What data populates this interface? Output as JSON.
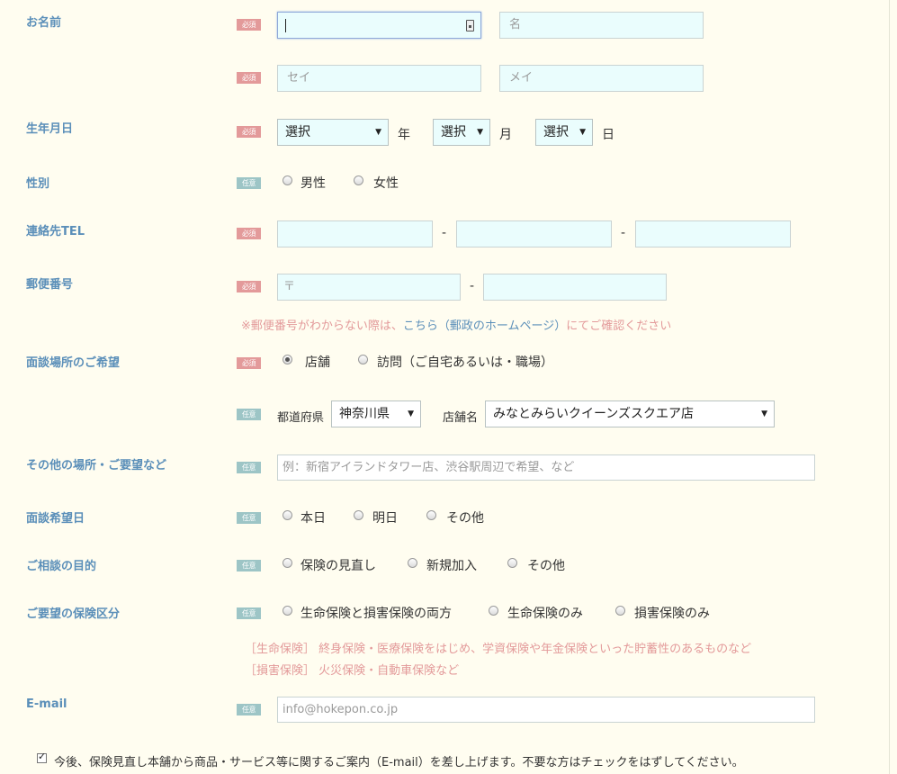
{
  "badges": {
    "required": "必須",
    "optional": "任意"
  },
  "name": {
    "label": "お名前",
    "sei_placeholder": "",
    "mei_placeholder": "名",
    "kana_sei_placeholder": "セイ",
    "kana_mei_placeholder": "メイ"
  },
  "birth": {
    "label": "生年月日",
    "year_value": "選択",
    "year_unit": "年",
    "month_value": "選択",
    "month_unit": "月",
    "day_value": "選択",
    "day_unit": "日"
  },
  "gender": {
    "label": "性別",
    "options": [
      "男性",
      "女性"
    ]
  },
  "tel": {
    "label": "連絡先TEL",
    "sep": "-"
  },
  "zip": {
    "label": "郵便番号",
    "prefix": "〒",
    "sep": "-",
    "note_prefix": "※郵便番号がわからない際は、",
    "note_link": "こちら（郵政のホームページ）",
    "note_suffix": "にてご確認ください"
  },
  "meeting_place": {
    "label": "面談場所のご希望",
    "options": [
      "店舗",
      "訪問（ご自宅あるいは・職場）"
    ],
    "selected": "店舗",
    "pref_label": "都道府県",
    "pref_value": "神奈川県",
    "shop_label": "店舗名",
    "shop_value": "みなとみらいクイーンズスクエア店"
  },
  "other_place": {
    "label": "その他の場所・ご要望など",
    "placeholder": "例：新宿アイランドタワー店、渋谷駅周辺で希望、など"
  },
  "meeting_date": {
    "label": "面談希望日",
    "options": [
      "本日",
      "明日",
      "その他"
    ]
  },
  "purpose": {
    "label": "ご相談の目的",
    "options": [
      "保険の見直し",
      "新規加入",
      "その他"
    ]
  },
  "insurance_type": {
    "label": "ご要望の保険区分",
    "options": [
      "生命保険と損害保険の両方",
      "生命保険のみ",
      "損害保険のみ"
    ],
    "note1": "［生命保険］ 終身保険・医療保険をはじめ、学資保険や年金保険といった貯蓄性のあるものなど",
    "note2": "［損害保険］ 火災保険・自動車保険など"
  },
  "email": {
    "label": "E-mail",
    "placeholder": "info@hokepon.co.jp"
  },
  "newsletter": {
    "text": "今後、保険見直し本舗から商品・サービス等に関するご案内（E-mail）を差し上げます。不要な方はチェックをはずしてください。",
    "checked": true
  }
}
